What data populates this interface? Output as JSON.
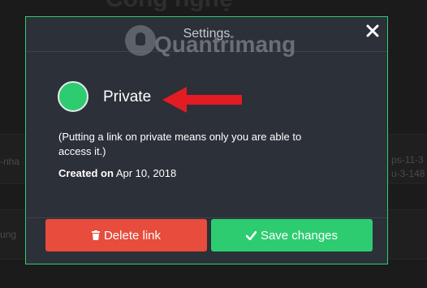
{
  "background": {
    "title": "Công nghệ",
    "left_snippet_1": "-nha",
    "left_snippet_2": "ung",
    "right_snippet_1": "ps-11-3",
    "right_snippet_2": "u-3-148"
  },
  "modal": {
    "title": "Settings",
    "close_label": "✕",
    "watermark": "Quantrimang",
    "privacy": {
      "label": "Private",
      "enabled": true,
      "note": "(Putting a link on private means only you are able to access it.)"
    },
    "created": {
      "label": "Created on",
      "date": "Apr 10, 2018"
    },
    "buttons": {
      "delete_label": "Delete link",
      "save_label": "Save changes"
    }
  },
  "colors": {
    "accent_green": "#2ecc71",
    "danger_red": "#e74c3c",
    "modal_bg": "#2c3038"
  },
  "icons": {
    "close": "close-icon",
    "trash": "trash-icon",
    "check": "check-icon",
    "arrow": "arrow-left-icon"
  }
}
